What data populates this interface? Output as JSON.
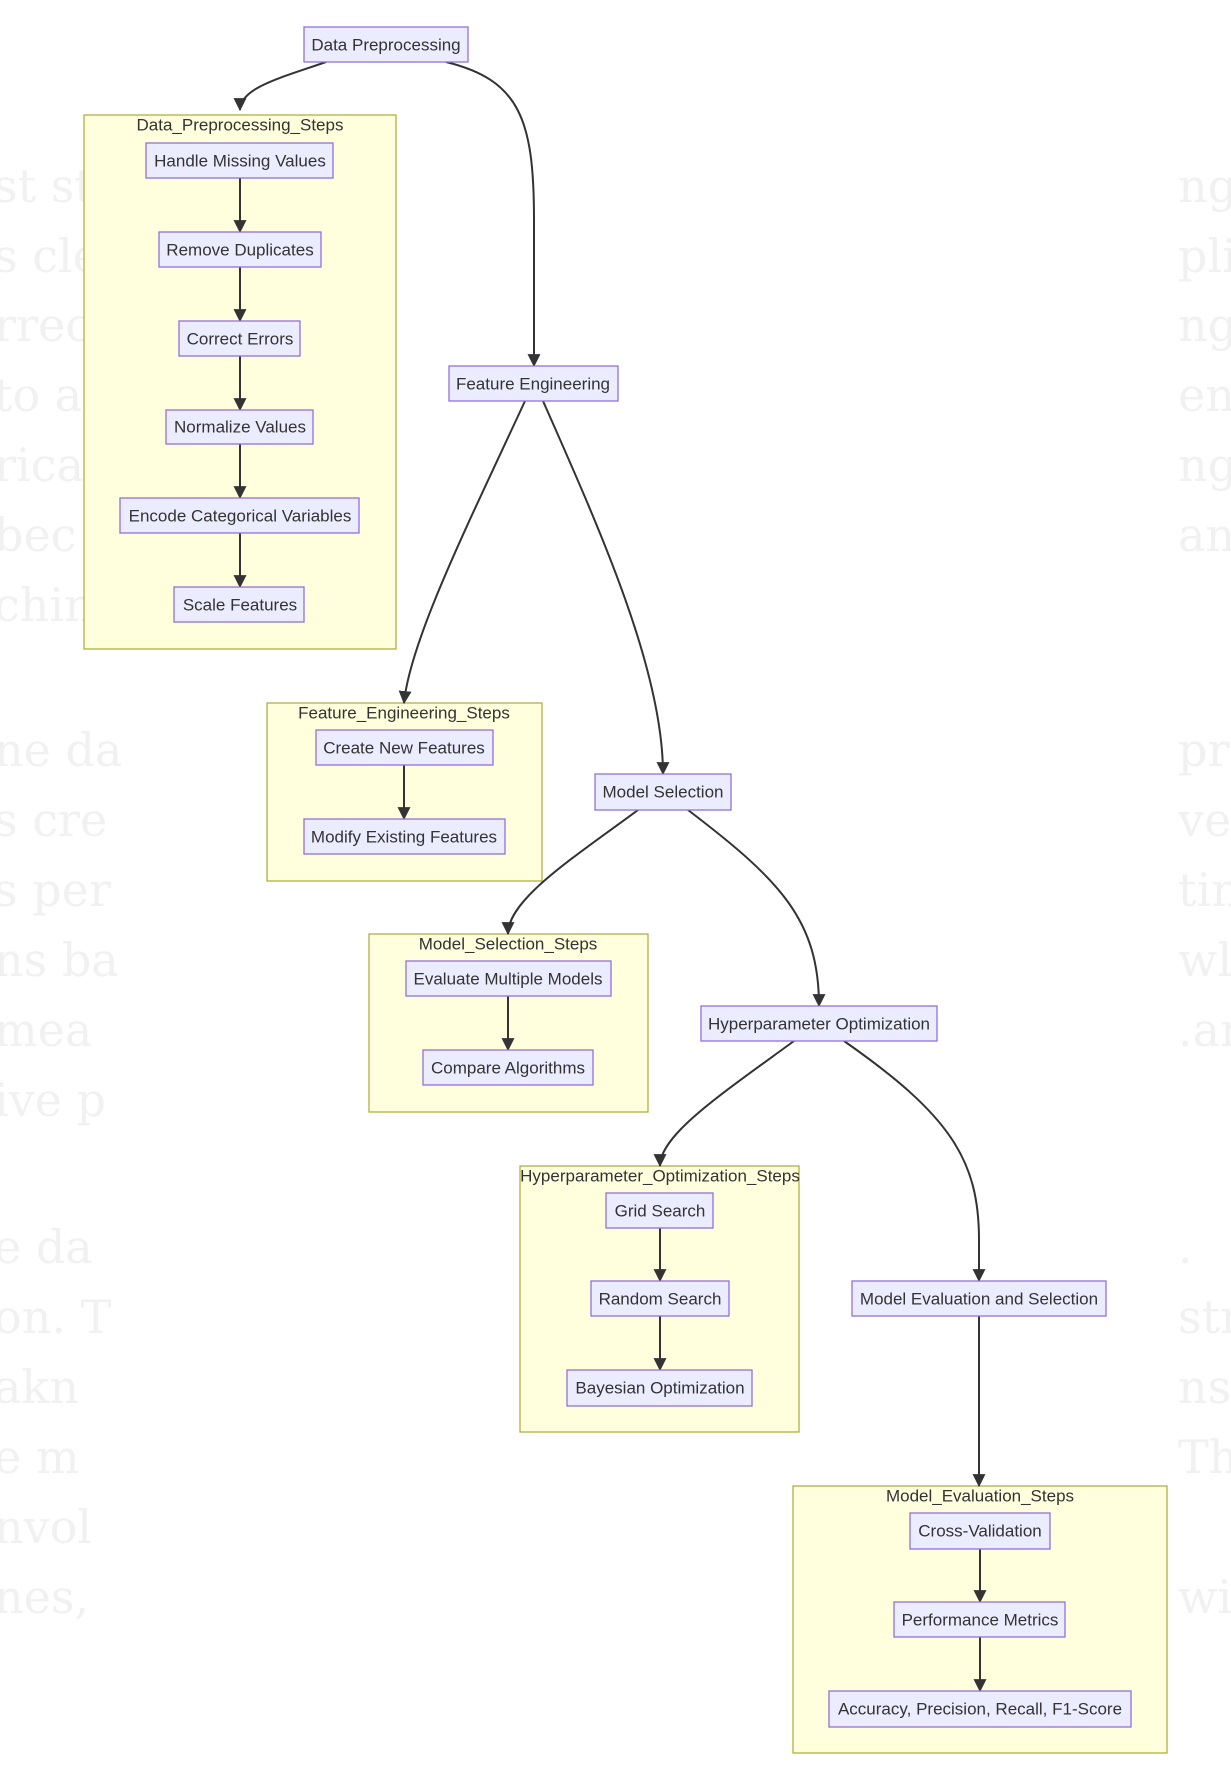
{
  "diagram": {
    "type": "flowchart",
    "colors": {
      "node_fill": "#ececff",
      "node_stroke": "#9370db",
      "cluster_fill": "#ffffde",
      "cluster_stroke": "#aaaa33",
      "edge": "#333333",
      "text": "#333333"
    },
    "main_nodes": {
      "data_preprocessing": "Data Preprocessing",
      "feature_engineering": "Feature Engineering",
      "model_selection": "Model Selection",
      "hyperparameter_optimization": "Hyperparameter Optimization",
      "model_evaluation": "Model Evaluation and Selection"
    },
    "clusters": {
      "data_preprocessing_steps": {
        "title": "Data_Preprocessing_Steps",
        "nodes": [
          "Handle Missing Values",
          "Remove Duplicates",
          "Correct Errors",
          "Normalize Values",
          "Encode Categorical Variables",
          "Scale Features"
        ]
      },
      "feature_engineering_steps": {
        "title": "Feature_Engineering_Steps",
        "nodes": [
          "Create New Features",
          "Modify Existing Features"
        ]
      },
      "model_selection_steps": {
        "title": "Model_Selection_Steps",
        "nodes": [
          "Evaluate Multiple Models",
          "Compare Algorithms"
        ]
      },
      "hyperparameter_optimization_steps": {
        "title": "Hyperparameter_Optimization_Steps",
        "nodes": [
          "Grid Search",
          "Random Search",
          "Bayesian Optimization"
        ]
      },
      "model_evaluation_steps": {
        "title": "Model_Evaluation_Steps",
        "nodes": [
          "Cross-Validation",
          "Performance Metrics",
          "Accuracy, Precision, Recall, F1-Score"
        ]
      }
    },
    "edges": [
      [
        "Data Preprocessing",
        "Data_Preprocessing_Steps"
      ],
      [
        "Data Preprocessing",
        "Feature Engineering"
      ],
      [
        "Handle Missing Values",
        "Remove Duplicates"
      ],
      [
        "Remove Duplicates",
        "Correct Errors"
      ],
      [
        "Correct Errors",
        "Normalize Values"
      ],
      [
        "Normalize Values",
        "Encode Categorical Variables"
      ],
      [
        "Encode Categorical Variables",
        "Scale Features"
      ],
      [
        "Feature Engineering",
        "Feature_Engineering_Steps"
      ],
      [
        "Feature Engineering",
        "Model Selection"
      ],
      [
        "Create New Features",
        "Modify Existing Features"
      ],
      [
        "Model Selection",
        "Model_Selection_Steps"
      ],
      [
        "Model Selection",
        "Hyperparameter Optimization"
      ],
      [
        "Evaluate Multiple Models",
        "Compare Algorithms"
      ],
      [
        "Hyperparameter Optimization",
        "Hyperparameter_Optimization_Steps"
      ],
      [
        "Hyperparameter Optimization",
        "Model Evaluation and Selection"
      ],
      [
        "Grid Search",
        "Random Search"
      ],
      [
        "Random Search",
        "Bayesian Optimization"
      ],
      [
        "Model Evaluation and Selection",
        "Model_Evaluation_Steps"
      ],
      [
        "Cross-Validation",
        "Performance Metrics"
      ],
      [
        "Performance Metrics",
        "Accuracy, Precision, Recall, F1-Score"
      ]
    ]
  },
  "background_text": {
    "left": [
      "st st",
      "s cle",
      "rrect",
      "to a",
      "rical",
      "bec",
      "chin",
      "ne da",
      "s cre",
      "s per",
      "ns ba",
      "mea",
      "ive p",
      "e da",
      "on. T",
      "akn",
      "e m",
      "nvol",
      "nes, "
    ],
    "right": [
      "ng.",
      "pli",
      "ng t",
      " en",
      "ng",
      "and",
      "pro",
      "ve t",
      "tin",
      "wle",
      ".an",
      ".",
      " str",
      "ns",
      " Th",
      "wit"
    ]
  }
}
